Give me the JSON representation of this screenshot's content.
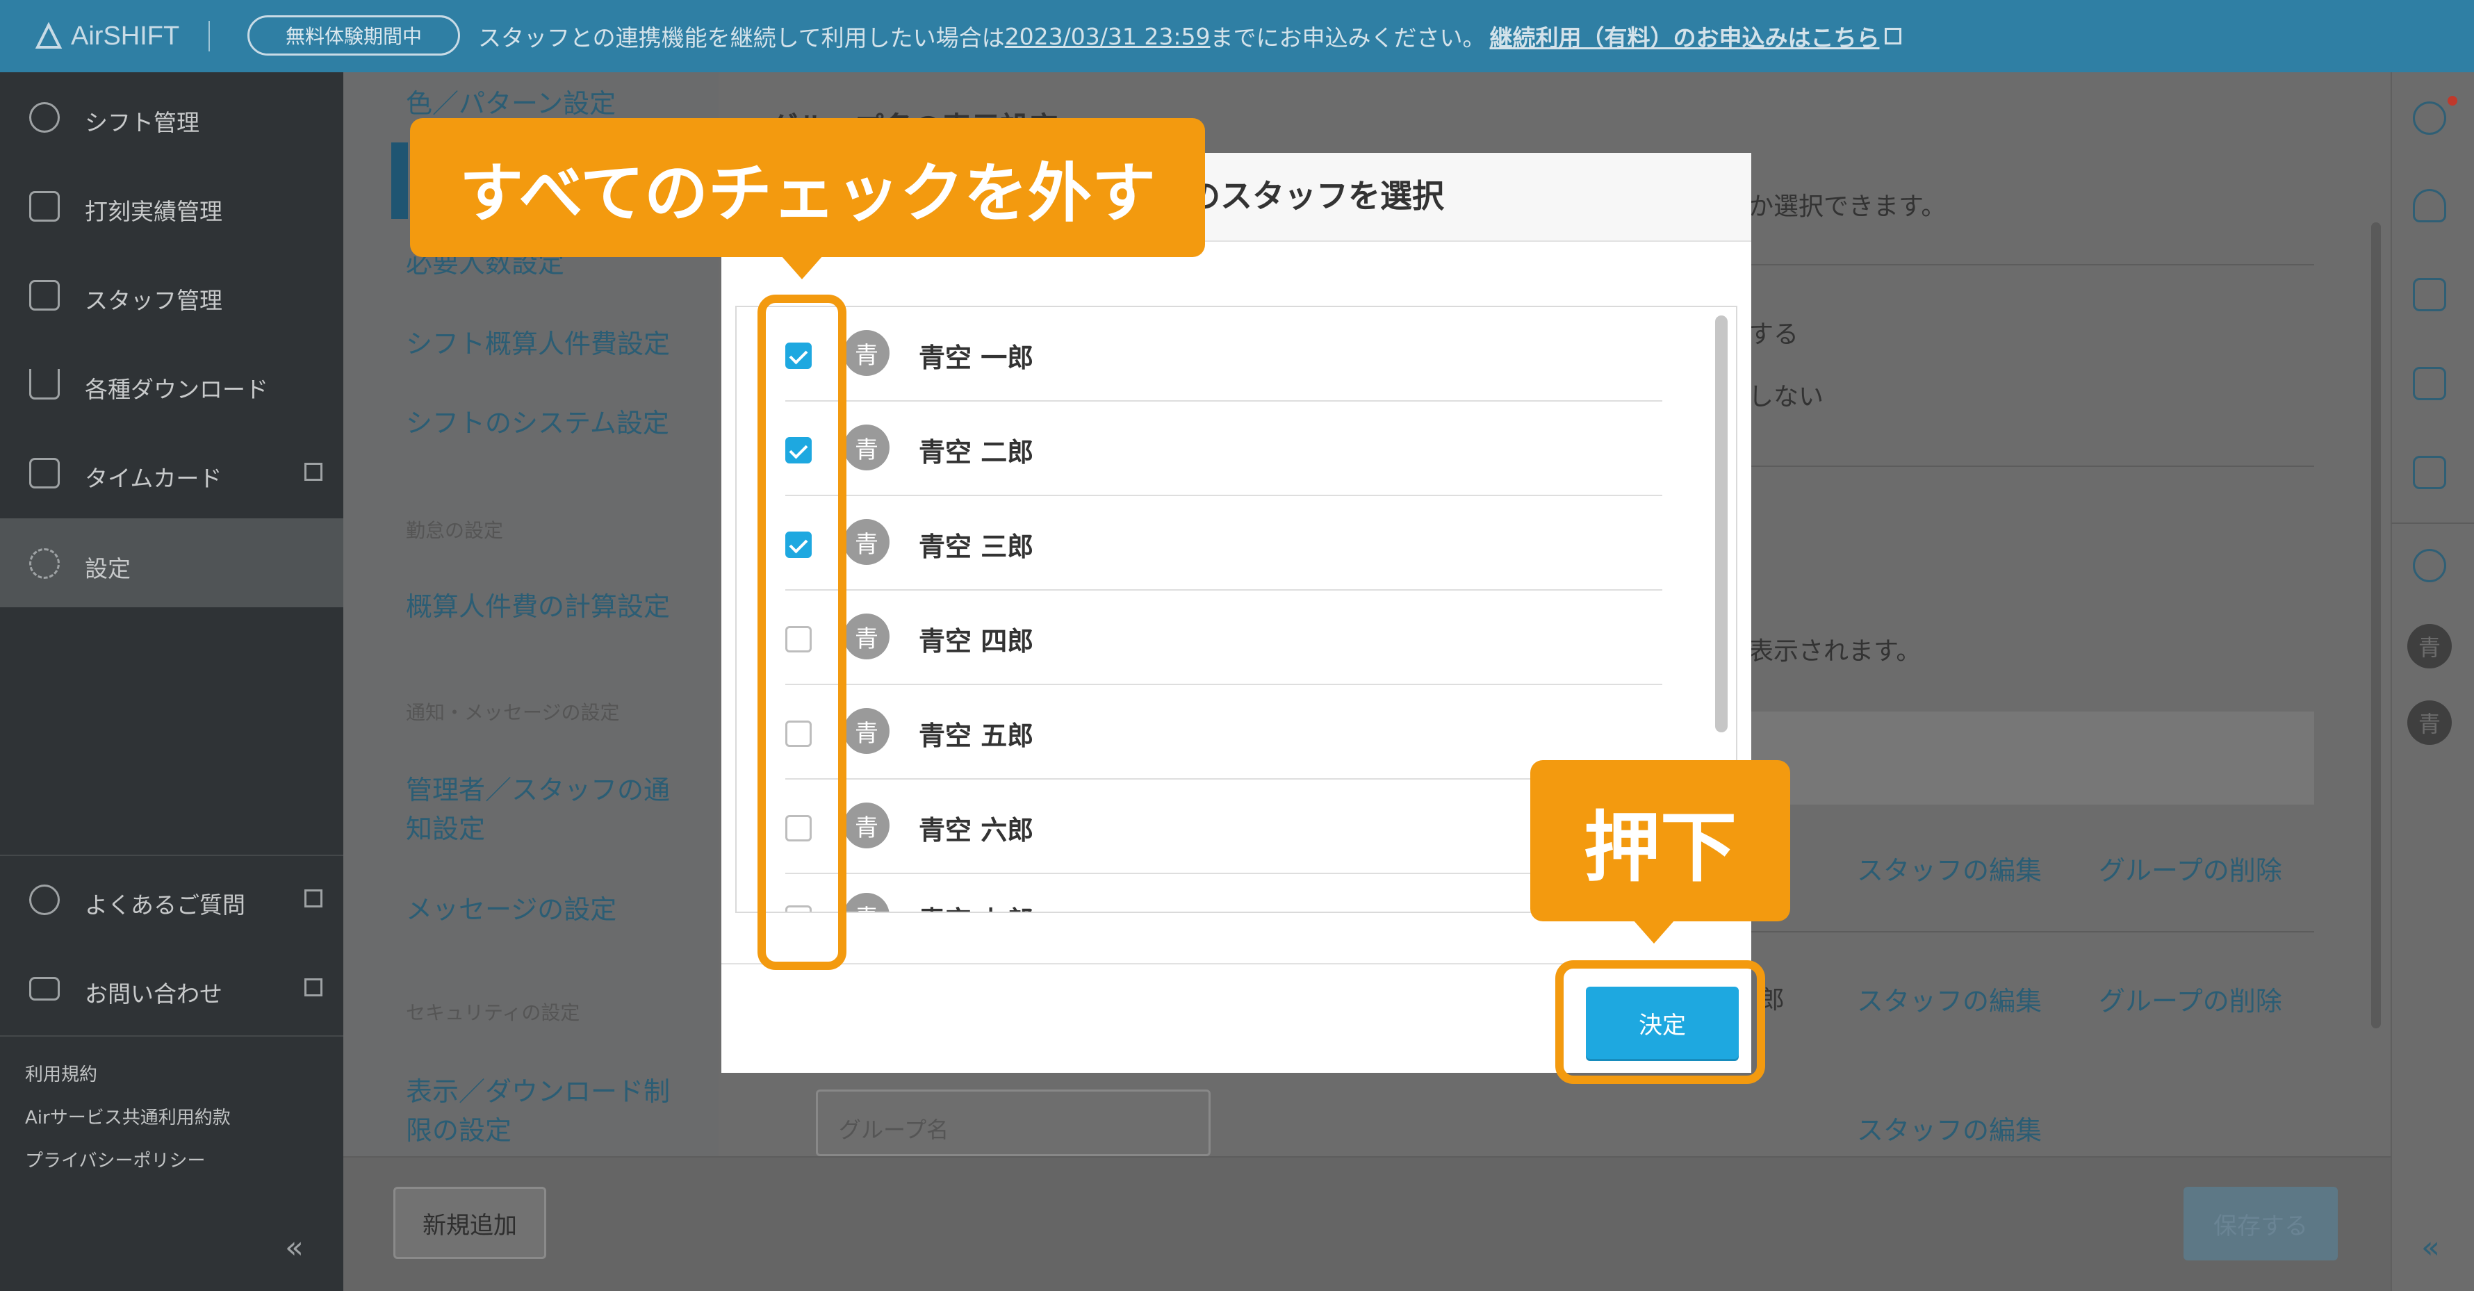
{
  "topbar": {
    "logo": "AirSHIFT",
    "trial_badge": "無料体験期間中",
    "notice_pre": "スタッフとの連携機能を継続して利用したい場合は",
    "notice_deadline": "2023/03/31 23:59",
    "notice_post": "までにお申込みください。",
    "notice_link": "継続利用（有料）のお申込みはこちら"
  },
  "sidebar": {
    "items": [
      {
        "label": "シフト管理",
        "icon": "shift-icon"
      },
      {
        "label": "打刻実績管理",
        "icon": "timestamp-icon"
      },
      {
        "label": "スタッフ管理",
        "icon": "staff-icon"
      },
      {
        "label": "各種ダウンロード",
        "icon": "download-icon"
      },
      {
        "label": "タイムカード",
        "icon": "timecard-icon"
      },
      {
        "label": "設定",
        "icon": "gear-icon"
      }
    ],
    "help": [
      {
        "label": "よくあるご質問",
        "icon": "question-icon"
      },
      {
        "label": "お問い合わせ",
        "icon": "mail-icon"
      }
    ],
    "links": [
      "利用規約",
      "Airサービス共通利用約款",
      "プライバシーポリシー"
    ],
    "collapse": "«"
  },
  "settings_nav": {
    "link_color_pattern": "色／パターン設定",
    "link_required": "必要人数設定",
    "link_cost": "シフト概算人件費設定",
    "link_system": "シフトのシステム設定",
    "head_attendance": "勤怠の設定",
    "link_calc": "概算人件費の計算設定",
    "head_notify": "通知・メッセージの設定",
    "link_notify_1": "管理者／スタッフの通",
    "link_notify_2": "知設定",
    "link_message": "メッセージの設定",
    "head_security": "セキュリティの設定",
    "link_restrict_1": "表示／ダウンロード制",
    "link_restrict_2": "限の設定"
  },
  "main": {
    "section_title": "グループ名の表示設定",
    "selectable_text": "か選択できます。",
    "option_1": "する",
    "option_2": "しない",
    "display_text": "表示されます。",
    "edit_staff": "スタッフの編集",
    "delete_group": "グループの削除",
    "row2_tail": "郎",
    "group_name_placeholder": "グループ名",
    "add_button": "新規追加",
    "save_button": "保存する"
  },
  "modal": {
    "title": "のスタッフを選択",
    "staff": [
      {
        "avatar": "青",
        "name": "青空 一郎",
        "checked": true
      },
      {
        "avatar": "青",
        "name": "青空 二郎",
        "checked": true
      },
      {
        "avatar": "青",
        "name": "青空 三郎",
        "checked": true
      },
      {
        "avatar": "青",
        "name": "青空 四郎",
        "checked": false
      },
      {
        "avatar": "青",
        "name": "青空 五郎",
        "checked": false
      },
      {
        "avatar": "青",
        "name": "青空 六郎",
        "checked": false
      },
      {
        "avatar": "青",
        "name": "青空 七郎",
        "checked": false
      }
    ],
    "confirm_button": "決定"
  },
  "right_rail": {
    "avatars": [
      "青",
      "青"
    ],
    "collapse": "«"
  },
  "callouts": {
    "uncheck_all": "すべてのチェックを外す",
    "press": "押下"
  },
  "colors": {
    "accent": "#1ea8e0",
    "callout": "#f39a0f",
    "topbar": "#2f7fa4",
    "sidebar": "#2f3336"
  }
}
